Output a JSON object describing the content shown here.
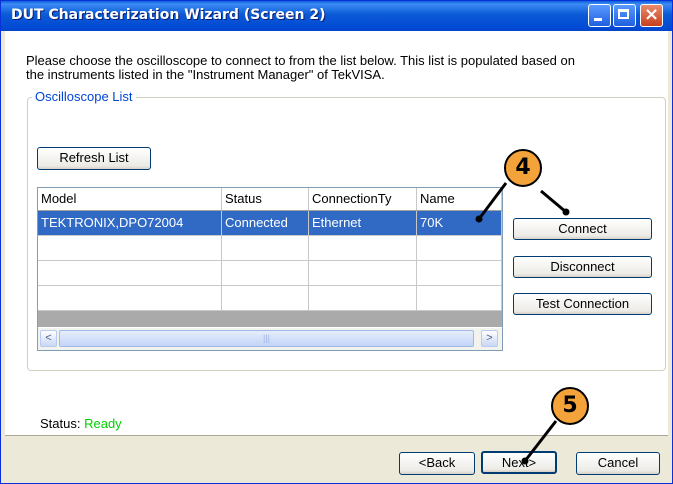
{
  "window": {
    "title": "DUT Characterization Wizard (Screen 2)"
  },
  "description": "Please choose the oscilloscope to connect to from the list below. This list is populated based on the instruments listed in the \"Instrument Manager\" of TekVISA.",
  "oscilloscope_list": {
    "legend": "Oscilloscope List",
    "refresh_label": "Refresh List",
    "columns": [
      "Model",
      "Status",
      "ConnectionTy",
      "Name"
    ],
    "rows": [
      {
        "model": "TEKTRONIX,DPO72004",
        "status": "Connected",
        "connection_type": "Ethernet",
        "name": "70K",
        "selected": true
      }
    ],
    "connect_label": "Connect",
    "disconnect_label": "Disconnect",
    "test_connection_label": "Test Connection"
  },
  "status": {
    "label": "Status:",
    "value": "Ready",
    "value_color": "#00D100"
  },
  "footer": {
    "back_label": "<Back",
    "next_label": "Next>",
    "cancel_label": "Cancel"
  },
  "callouts": {
    "step_4": "4",
    "step_5": "5",
    "color": "#F4A33A"
  }
}
